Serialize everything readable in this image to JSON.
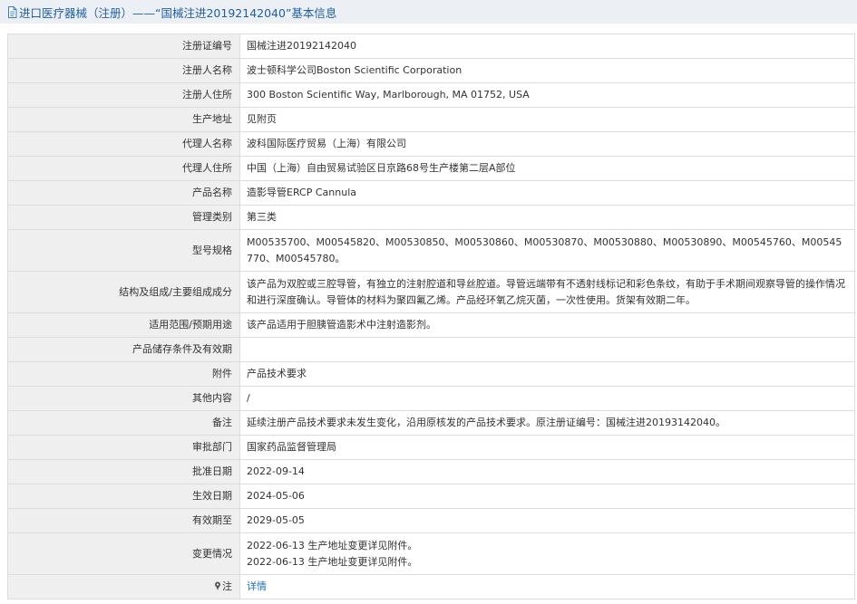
{
  "header": {
    "title": "进口医疗器械（注册）——“国械注进20192142040”基本信息",
    "icon": "document-icon"
  },
  "rows": [
    {
      "label": "注册证编号",
      "value": "国械注进20192142040"
    },
    {
      "label": "注册人名称",
      "value": "波士顿科学公司Boston Scientific Corporation"
    },
    {
      "label": "注册人住所",
      "value": "300 Boston Scientific Way, Marlborough, MA 01752, USA"
    },
    {
      "label": "生产地址",
      "value": "见附页"
    },
    {
      "label": "代理人名称",
      "value": "波科国际医疗贸易（上海）有限公司"
    },
    {
      "label": "代理人住所",
      "value": "中国（上海）自由贸易试验区日京路68号生产楼第二层A部位"
    },
    {
      "label": "产品名称",
      "value": "造影导管ERCP Cannula"
    },
    {
      "label": "管理类别",
      "value": "第三类"
    },
    {
      "label": "型号规格",
      "value": "M00535700、M00545820、M00530850、M00530860、M00530870、M00530880、M00530890、M00545760、M00545770、M00545780。"
    },
    {
      "label": "结构及组成/主要组成成分",
      "value": "该产品为双腔或三腔导管，有独立的注射腔道和导丝腔道。导管远端带有不透射线标记和彩色条纹，有助于手术期间观察导管的操作情况和进行深度确认。导管体的材料为聚四氟乙烯。产品经环氧乙烷灭菌，一次性使用。货架有效期二年。"
    },
    {
      "label": "适用范围/预期用途",
      "value": "该产品适用于胆胰管造影术中注射造影剂。"
    },
    {
      "label": "产品储存条件及有效期",
      "value": ""
    },
    {
      "label": "附件",
      "value": "产品技术要求"
    },
    {
      "label": "其他内容",
      "value": "/"
    },
    {
      "label": "备注",
      "value": "延续注册产品技术要求未发生变化，沿用原核发的产品技术要求。原注册证编号：国械注进20193142040。"
    },
    {
      "label": "审批部门",
      "value": "国家药品监督管理局"
    },
    {
      "label": "批准日期",
      "value": "2022-09-14"
    },
    {
      "label": "生效日期",
      "value": "2024-05-06"
    },
    {
      "label": "有效期至",
      "value": "2029-05-05"
    }
  ],
  "changes": {
    "label": "变更情况",
    "lines": [
      "2022-06-13 生产地址变更详见附件。",
      "2022-06-13 生产地址变更详见附件。"
    ]
  },
  "note": {
    "label": "注",
    "icon": "pin-icon",
    "link": "详情"
  },
  "colors": {
    "title_text": "#1d5fa8",
    "title_bg": "#eceff3",
    "label_bg": "#efefef",
    "border": "#dcdcdc",
    "link": "#1d6fc4"
  }
}
